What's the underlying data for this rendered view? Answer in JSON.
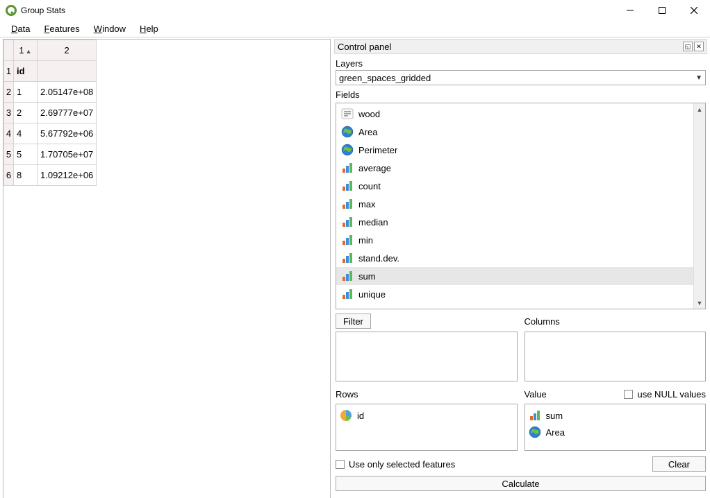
{
  "window": {
    "title": "Group Stats"
  },
  "menu": {
    "data": "Data",
    "features": "Features",
    "windowm": "Window",
    "help": "Help"
  },
  "table": {
    "col1": "1",
    "col2": "2",
    "rows": [
      {
        "n": "1",
        "a": "id",
        "b": ""
      },
      {
        "n": "2",
        "a": "1",
        "b": "2.05147e+08"
      },
      {
        "n": "3",
        "a": "2",
        "b": "2.69777e+07"
      },
      {
        "n": "4",
        "a": "4",
        "b": "5.67792e+06"
      },
      {
        "n": "5",
        "a": "5",
        "b": "1.70705e+07"
      },
      {
        "n": "6",
        "a": "8",
        "b": "1.09212e+06"
      }
    ]
  },
  "panel": {
    "title": "Control panel",
    "layers_label": "Layers",
    "layer_selected": "green_spaces_gridded",
    "fields_label": "Fields",
    "fields": [
      {
        "icon": "text",
        "label": "wood"
      },
      {
        "icon": "globe",
        "label": "Area"
      },
      {
        "icon": "globe",
        "label": "Perimeter"
      },
      {
        "icon": "bars",
        "label": "average"
      },
      {
        "icon": "bars",
        "label": "count"
      },
      {
        "icon": "bars",
        "label": "max"
      },
      {
        "icon": "bars",
        "label": "median"
      },
      {
        "icon": "bars",
        "label": "min"
      },
      {
        "icon": "bars",
        "label": "stand.dev."
      },
      {
        "icon": "bars",
        "label": "sum",
        "selected": true
      },
      {
        "icon": "bars",
        "label": "unique"
      }
    ],
    "filter_label": "Filter",
    "columns_label": "Columns",
    "rows_label": "Rows",
    "value_label": "Value",
    "use_null_label": "use NULL values",
    "rows_items": [
      {
        "icon": "pie",
        "label": "id"
      }
    ],
    "value_items": [
      {
        "icon": "bars",
        "label": "sum"
      },
      {
        "icon": "globe",
        "label": "Area"
      }
    ],
    "use_selected_label": "Use only selected features",
    "clear_label": "Clear",
    "calculate_label": "Calculate"
  }
}
